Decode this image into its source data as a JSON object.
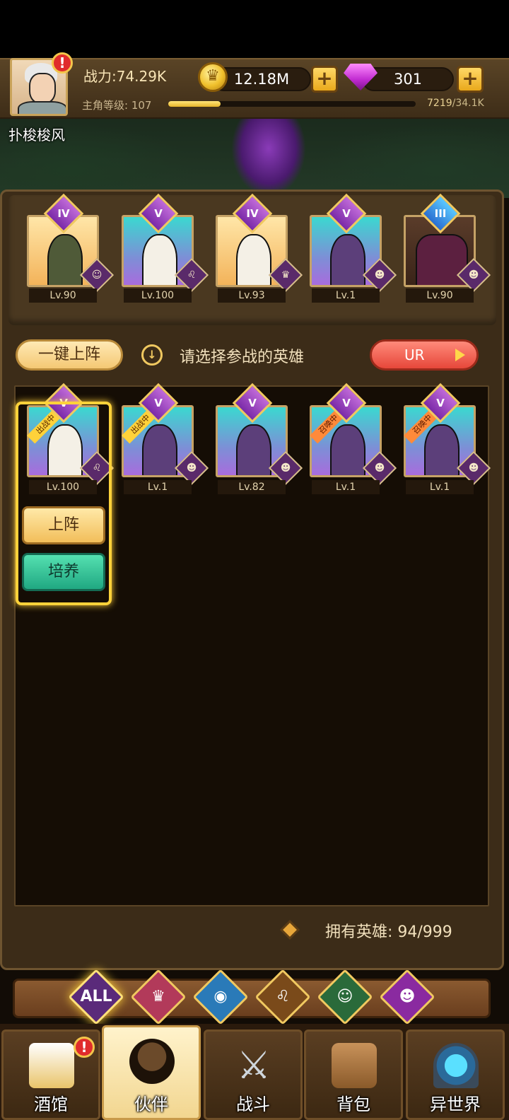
{
  "player": {
    "power": "战力:74.29K",
    "level_label": "主角等级: 107",
    "exp_current": "7219",
    "exp_max": "/34.1K",
    "exp_fraction": 0.21,
    "name": "扑梭梭风",
    "alert": "!"
  },
  "currency": {
    "gold": "12.18M",
    "gems": "301",
    "plus": "+"
  },
  "team": [
    {
      "rank": "IV",
      "level": "Lv.90"
    },
    {
      "rank": "V",
      "level": "Lv.100"
    },
    {
      "rank": "IV",
      "level": "Lv.93"
    },
    {
      "rank": "V",
      "level": "Lv.1"
    },
    {
      "rank": "III",
      "level": "Lv.90"
    }
  ],
  "actions": {
    "auto_deploy": "一键上阵",
    "prompt": "请选择参战的英雄",
    "rarity_filter": "UR",
    "deploy": "上阵",
    "train": "培养"
  },
  "roster": [
    {
      "rank": "V",
      "level": "Lv.100",
      "tag": "出战中"
    },
    {
      "rank": "V",
      "level": "Lv.1",
      "tag": "出战中"
    },
    {
      "rank": "V",
      "level": "Lv.82",
      "tag": ""
    },
    {
      "rank": "V",
      "level": "Lv.1",
      "tag": "召唤中"
    },
    {
      "rank": "V",
      "level": "Lv.1",
      "tag": "召唤中"
    }
  ],
  "owned_heroes": "拥有英雄: 94/999",
  "filters": [
    "ALL",
    "",
    "",
    "",
    "",
    ""
  ],
  "filter_icons": [
    "all",
    "elf-warrior-icon",
    "fish-icon",
    "lion-icon",
    "elf-girl-icon",
    "demon-icon"
  ],
  "nav": {
    "tavern": "酒馆",
    "partners": "伙伴",
    "battle": "战斗",
    "bag": "背包",
    "otherworld": "异世界"
  },
  "colors": {
    "gold_accent": "#f0c860",
    "panel": "#3c2c18",
    "selected_glow": "#ffd23a"
  }
}
